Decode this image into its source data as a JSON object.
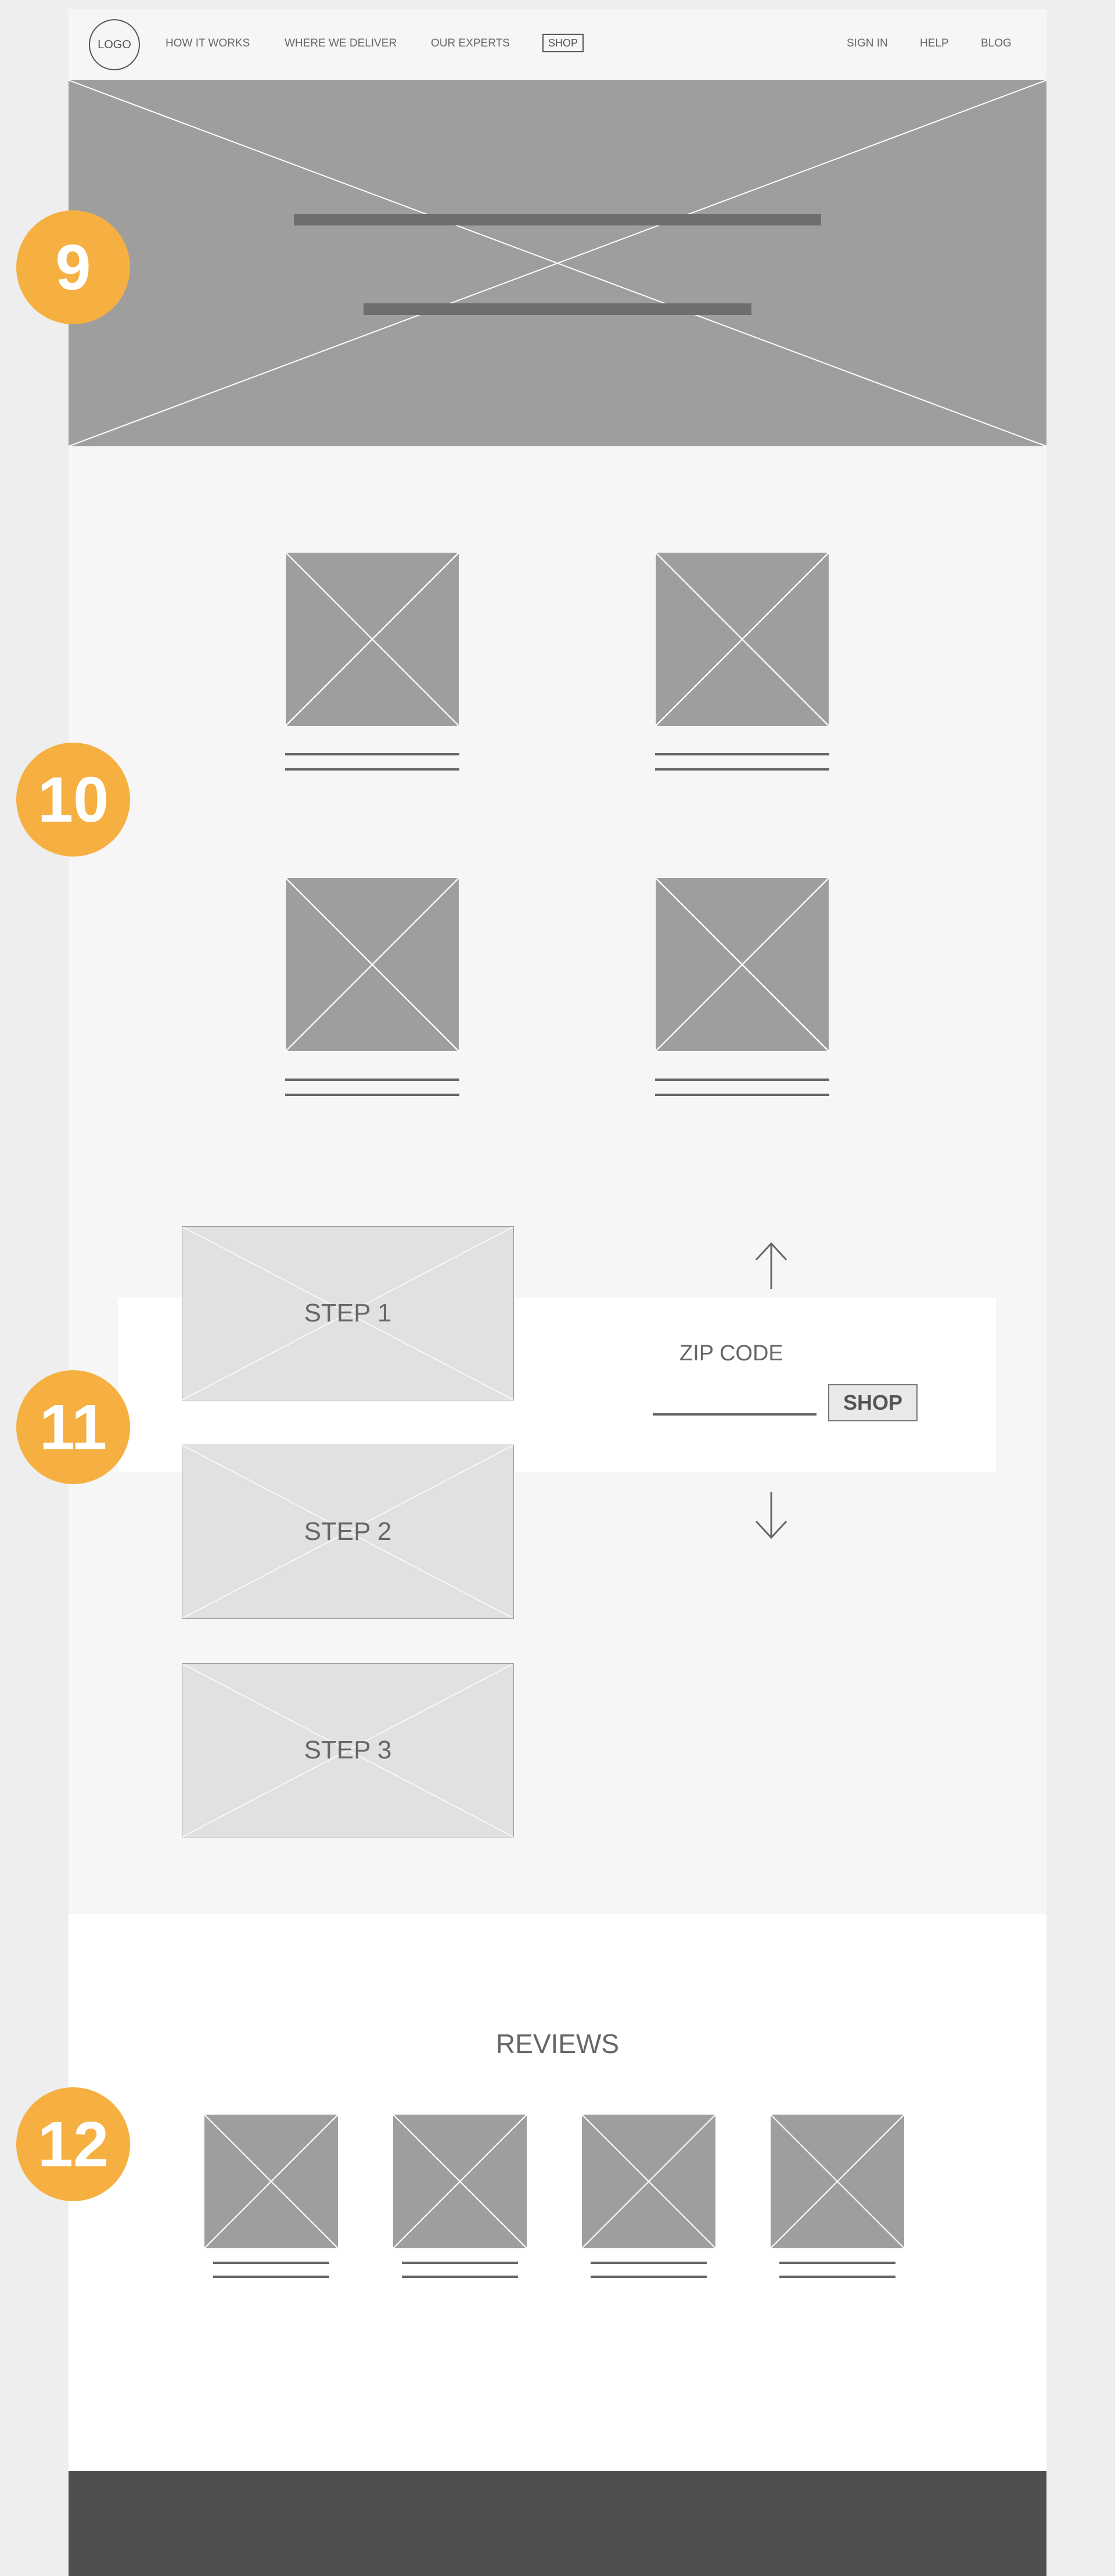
{
  "header": {
    "logo": "LOGO",
    "nav": [
      "HOW IT WORKS",
      "WHERE WE DELIVER",
      "OUR EXPERTS"
    ],
    "shop": "SHOP",
    "right_nav": [
      "SIGN IN",
      "HELP",
      "BLOG"
    ]
  },
  "steps": {
    "items": [
      "STEP 1",
      "STEP 2",
      "STEP 3"
    ],
    "zip_label": "ZIP CODE",
    "zip_value": "",
    "shop_button": "SHOP"
  },
  "reviews": {
    "title": "REVIEWS"
  },
  "badges": [
    "9",
    "10",
    "11",
    "12"
  ],
  "colors": {
    "badge": "#f5b041",
    "placeholder": "#9e9e9e",
    "footer": "#4f4f4f",
    "section_bg": "#f6f6f6"
  },
  "icons": [
    "arrow-up-icon",
    "arrow-down-icon"
  ]
}
